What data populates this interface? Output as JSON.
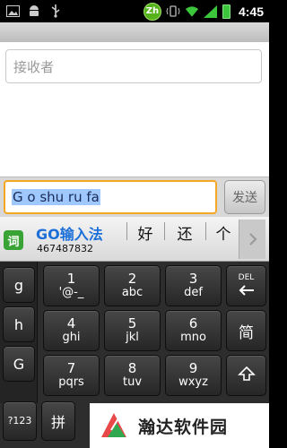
{
  "status_bar": {
    "time": "4:45",
    "ime_badge": "Zh",
    "icons": [
      "picture-icon",
      "android-icon",
      "usb-icon",
      "ime-zh-icon",
      "vibrate-icon",
      "wifi-icon",
      "signal-icon",
      "battery-icon"
    ]
  },
  "compose": {
    "recipient_placeholder": "接收者",
    "message_text": "G o shu ru fa",
    "send_label": "发送"
  },
  "candidate_bar": {
    "ime_icon_label": "词",
    "brand_go": "GO",
    "brand_name": "输入法",
    "code": "467487832",
    "candidates": [
      "好",
      "还",
      "个"
    ],
    "more_icon": "chevron-right-icon"
  },
  "keyboard": {
    "left_column": [
      "g",
      "h",
      "G"
    ],
    "rows": [
      [
        {
          "num": "1",
          "let": "'@-_"
        },
        {
          "num": "2",
          "let": "abc"
        },
        {
          "num": "3",
          "let": "def"
        }
      ],
      [
        {
          "num": "4",
          "let": "ghi"
        },
        {
          "num": "5",
          "let": "jkl"
        },
        {
          "num": "6",
          "let": "mno"
        }
      ],
      [
        {
          "num": "7",
          "let": "pqrs"
        },
        {
          "num": "8",
          "let": "tuv"
        },
        {
          "num": "9",
          "let": "wxyz"
        }
      ]
    ],
    "del_label": "DEL",
    "jian_label": "简",
    "bottom_left_label": "?123",
    "pinyin_label": "拼"
  },
  "watermark": {
    "text": "瀚达软件园"
  },
  "colors": {
    "accent_orange": "#f5a623",
    "brand_blue": "#1c6fd8",
    "selection": "#9ec8ff",
    "ime_green": "#3aa336"
  }
}
